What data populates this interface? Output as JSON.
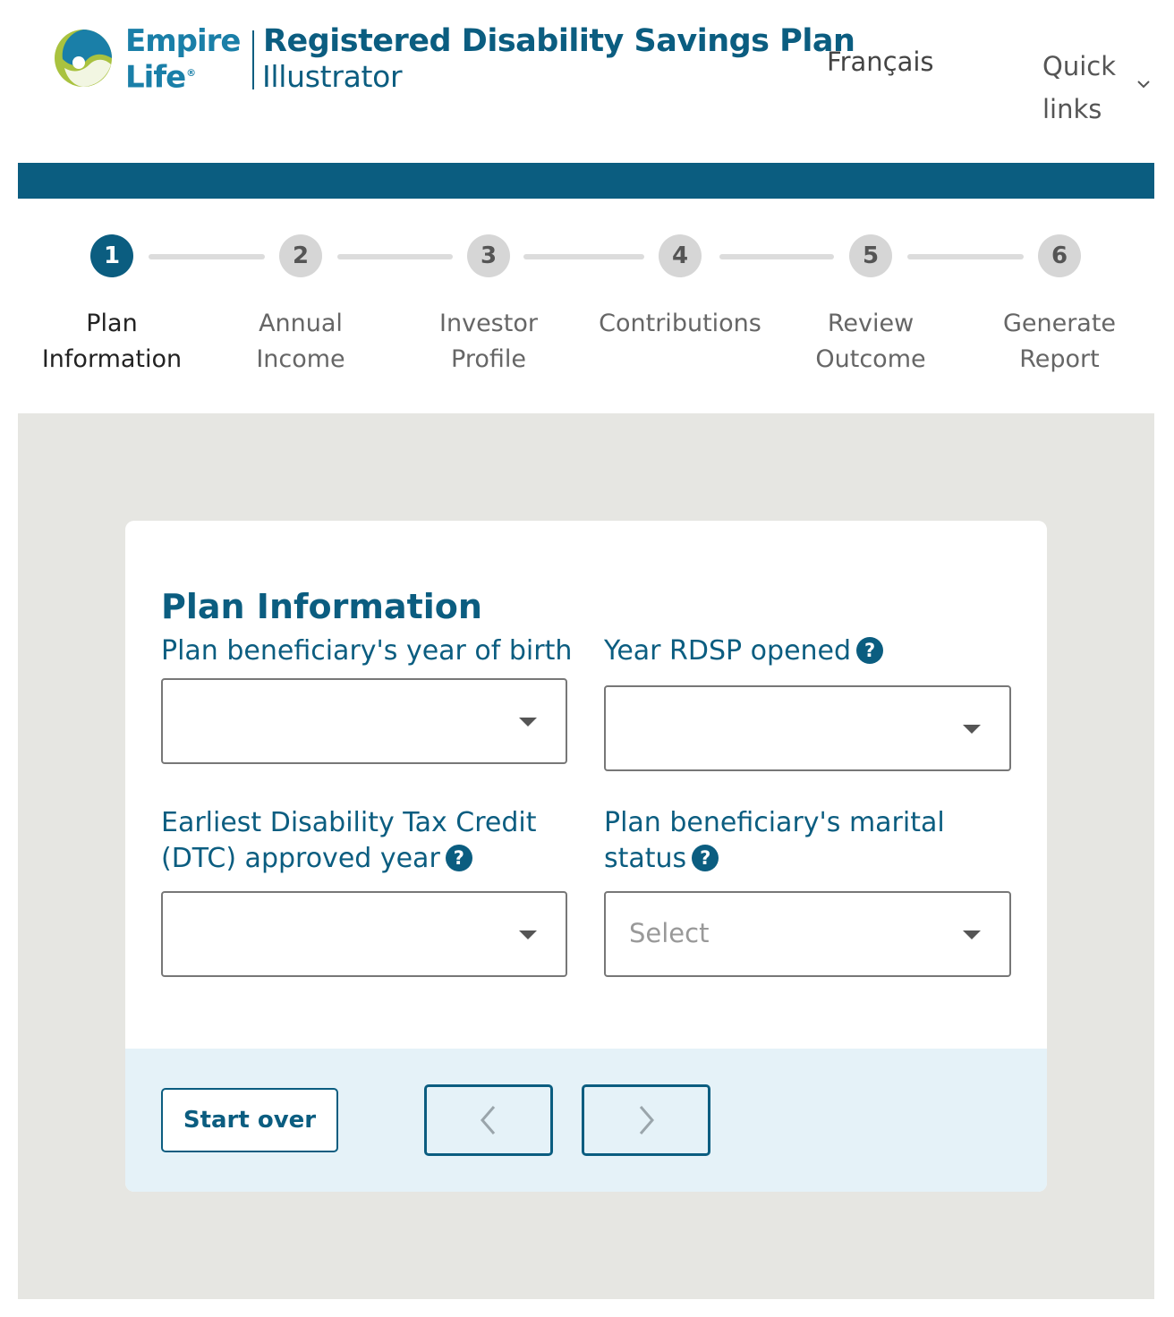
{
  "header": {
    "brand_line1": "Empire",
    "brand_line2": "Life",
    "brand_reg": "®",
    "title_main": "Registered Disability Savings Plan",
    "title_sub": "Illustrator",
    "language_link": "Français",
    "quick_links": "Quick links"
  },
  "colors": {
    "primary": "#0b5d80",
    "logo_green": "#a9c23f",
    "logo_blue": "#1a7fa8",
    "content_bg": "#e6e6e2",
    "footer_bg": "#e5f2f8"
  },
  "steps": [
    {
      "number": "1",
      "label_line1": "Plan",
      "label_line2": "Information",
      "active": true
    },
    {
      "number": "2",
      "label_line1": "Annual",
      "label_line2": "Income",
      "active": false
    },
    {
      "number": "3",
      "label_line1": "Investor",
      "label_line2": "Profile",
      "active": false
    },
    {
      "number": "4",
      "label_line1": "Contributions",
      "label_line2": "",
      "active": false
    },
    {
      "number": "5",
      "label_line1": "Review",
      "label_line2": "Outcome",
      "active": false
    },
    {
      "number": "6",
      "label_line1": "Generate",
      "label_line2": "Report",
      "active": false
    }
  ],
  "form": {
    "title": "Plan Information",
    "fields": {
      "birth_year": {
        "label": "Plan beneficiary's year of birth",
        "value": ""
      },
      "rdsp_opened": {
        "label": "Year RDSP opened",
        "value": ""
      },
      "dtc_year": {
        "label_line1": "Earliest Disability Tax Credit",
        "label_line2": "(DTC) approved year",
        "value": ""
      },
      "marital_status": {
        "label_line1": "Plan beneficiary's marital",
        "label_line2": "status",
        "placeholder": "Select"
      }
    },
    "help_glyph": "?"
  },
  "footer": {
    "start_over": "Start over",
    "prev_icon": "chevron-left-icon",
    "next_icon": "chevron-right-icon"
  }
}
